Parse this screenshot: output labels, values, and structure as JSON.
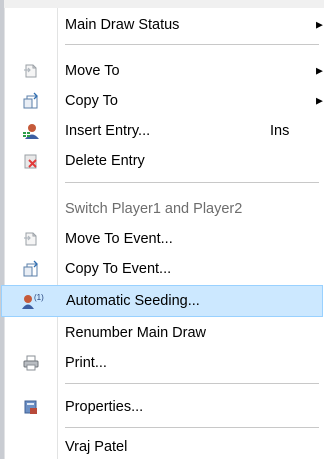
{
  "menu": {
    "items": [
      {
        "label": "Main Draw Status",
        "shortcut": "",
        "submenu": true,
        "icon": "none",
        "disabled": false,
        "highlighted": false
      },
      {
        "label": "Move To",
        "shortcut": "",
        "submenu": true,
        "icon": "move-icon",
        "disabled": false,
        "highlighted": false
      },
      {
        "label": "Copy To",
        "shortcut": "",
        "submenu": true,
        "icon": "copy-icon",
        "disabled": false,
        "highlighted": false
      },
      {
        "label": "Insert Entry...",
        "shortcut": "Ins",
        "submenu": false,
        "icon": "insert-user-icon",
        "disabled": false,
        "highlighted": false
      },
      {
        "label": "Delete Entry",
        "shortcut": "",
        "submenu": false,
        "icon": "delete-user-icon",
        "disabled": false,
        "highlighted": false
      },
      {
        "label": "Switch Player1 and Player2",
        "shortcut": "",
        "submenu": false,
        "icon": "none",
        "disabled": true,
        "highlighted": false
      },
      {
        "label": "Move To Event...",
        "shortcut": "",
        "submenu": false,
        "icon": "move-icon",
        "disabled": false,
        "highlighted": false
      },
      {
        "label": "Copy To Event...",
        "shortcut": "",
        "submenu": false,
        "icon": "copy-icon",
        "disabled": false,
        "highlighted": false
      },
      {
        "label": "Automatic Seeding...",
        "shortcut": "",
        "submenu": false,
        "icon": "seeding-icon",
        "disabled": false,
        "highlighted": true
      },
      {
        "label": "Renumber Main Draw",
        "shortcut": "",
        "submenu": false,
        "icon": "none",
        "disabled": false,
        "highlighted": false
      },
      {
        "label": "Print...",
        "shortcut": "",
        "submenu": false,
        "icon": "printer-icon",
        "disabled": false,
        "highlighted": false
      },
      {
        "label": "Properties...",
        "shortcut": "",
        "submenu": false,
        "icon": "properties-icon",
        "disabled": false,
        "highlighted": false
      },
      {
        "label": "Vraj Patel",
        "shortcut": "",
        "submenu": false,
        "icon": "none",
        "disabled": false,
        "highlighted": false
      }
    ],
    "submenu_arrow": "▶"
  },
  "colors": {
    "highlight_bg": "#cce8ff",
    "highlight_border": "#99d1ff",
    "disabled_text": "#6d6d6d",
    "separator": "#c8c8c8"
  }
}
